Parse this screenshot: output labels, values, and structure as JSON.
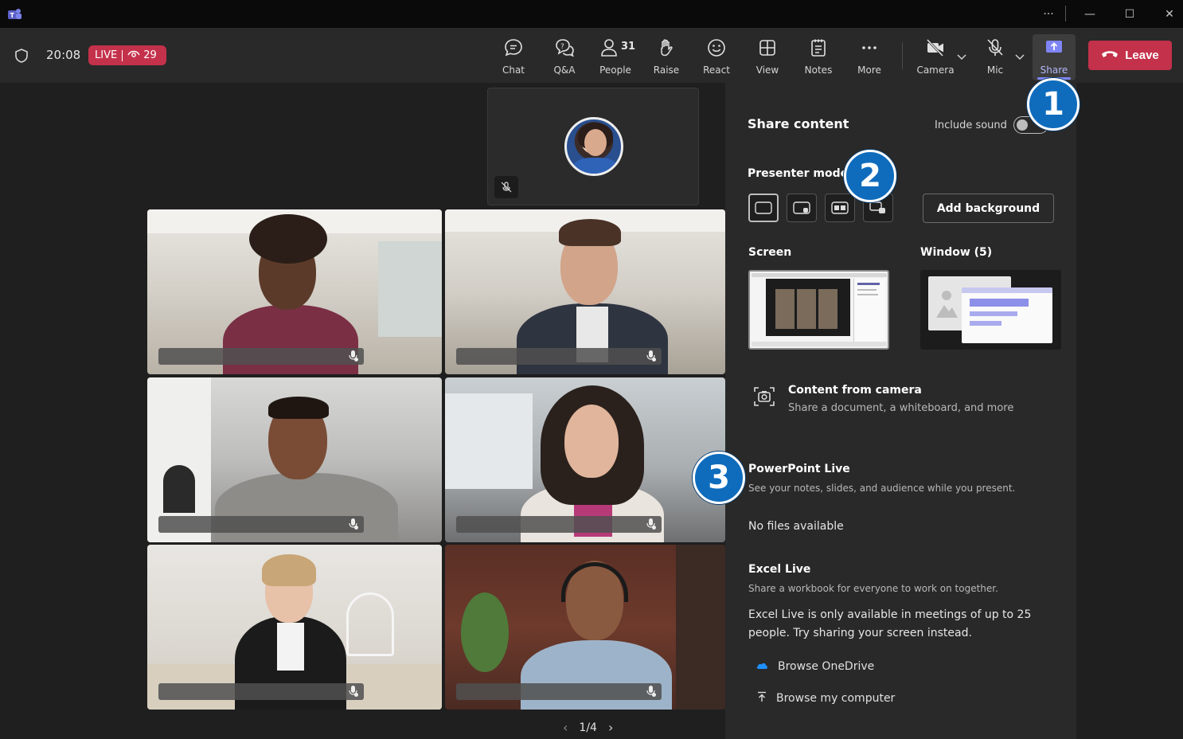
{
  "window": {
    "controls": {
      "more": "···",
      "minimize": "—",
      "maximize": "☐",
      "close": "✕"
    }
  },
  "toolbar": {
    "timer": "20:08",
    "live_label": "LIVE",
    "viewer_count": "29",
    "items": [
      {
        "label": "Chat",
        "icon": "chat-icon"
      },
      {
        "label": "Q&A",
        "icon": "qa-icon"
      },
      {
        "label": "People",
        "icon": "people-icon",
        "count": "31"
      },
      {
        "label": "Raise",
        "icon": "hand-icon"
      },
      {
        "label": "React",
        "icon": "smile-icon"
      },
      {
        "label": "View",
        "icon": "grid-icon"
      },
      {
        "label": "Notes",
        "icon": "notes-icon"
      },
      {
        "label": "More",
        "icon": "more-icon"
      },
      {
        "label": "Camera",
        "icon": "camera-off-icon"
      },
      {
        "label": "Mic",
        "icon": "mic-off-icon"
      },
      {
        "label": "Share",
        "icon": "share-icon"
      }
    ],
    "leave_label": "Leave",
    "accent": "#7f85f5",
    "leave_color": "#c4314b"
  },
  "stage": {
    "pager": "1/4"
  },
  "share_panel": {
    "title": "Share content",
    "include_sound_label": "Include sound",
    "include_sound_on": false,
    "presenter_mode_label": "Presenter mode",
    "add_background_label": "Add background",
    "screen_label": "Screen",
    "window_label": "Window (5)",
    "content_from_camera": {
      "title": "Content from camera",
      "subtitle": "Share a document, a whiteboard, and more"
    },
    "powerpoint_live": {
      "title": "PowerPoint Live",
      "subtitle": "See your notes, slides, and audience while you present.",
      "empty": "No files available"
    },
    "excel_live": {
      "title": "Excel Live",
      "subtitle": "Share a workbook for everyone to work on together.",
      "notice": "Excel Live is only available in meetings of up to 25 people. Try sharing your screen instead."
    },
    "browse_onedrive": "Browse OneDrive",
    "browse_computer": "Browse my computer"
  },
  "callouts": [
    "1",
    "2",
    "3"
  ]
}
